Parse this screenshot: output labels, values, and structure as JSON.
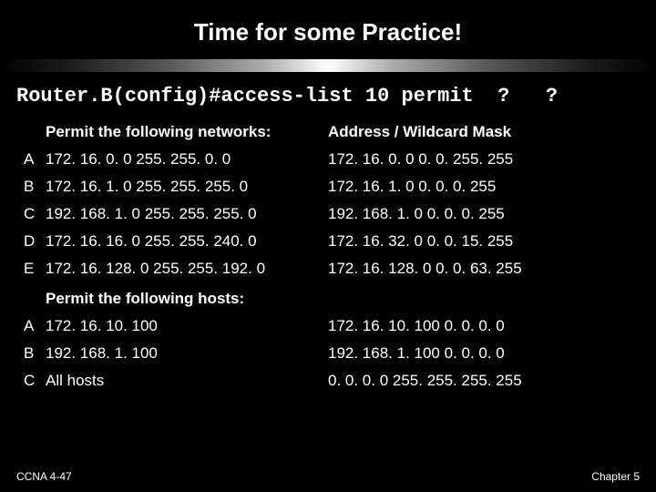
{
  "title": "Time for some Practice!",
  "command": "Router.B(config)#access-list 10 permit  ?   ?",
  "headers": {
    "networks": "Permit the following networks:",
    "mask": "Address / Wildcard Mask",
    "hosts": "Permit the following hosts:"
  },
  "networks": [
    {
      "label": "A",
      "left": "172. 16. 0. 0  255. 255. 0. 0",
      "right": "172. 16. 0. 0  0. 0. 255. 255"
    },
    {
      "label": "B",
      "left": "172. 16. 1. 0  255. 255. 255. 0",
      "right": "172. 16. 1. 0  0. 0. 0. 255"
    },
    {
      "label": "C",
      "left": "192. 168. 1. 0  255. 255. 255. 0",
      "right": "192. 168. 1. 0  0. 0. 0. 255"
    },
    {
      "label": "D",
      "left": "172. 16. 16. 0  255. 255. 240. 0",
      "right": "172. 16. 32. 0  0. 0. 15. 255"
    },
    {
      "label": "E",
      "left": "172. 16. 128. 0  255. 255. 192. 0",
      "right": "172. 16. 128. 0  0. 0. 63. 255"
    }
  ],
  "hosts": [
    {
      "label": "A",
      "left": "172. 16. 10. 100",
      "right": "172. 16. 10. 100  0. 0. 0. 0"
    },
    {
      "label": "B",
      "left": "192. 168. 1. 100",
      "right": "192. 168. 1. 100  0. 0. 0. 0"
    },
    {
      "label": "C",
      "left": "All hosts",
      "right": " 0. 0. 0. 0  255. 255. 255. 255"
    }
  ],
  "footer": {
    "left": "CCNA 4-47",
    "right": "Chapter 5"
  }
}
